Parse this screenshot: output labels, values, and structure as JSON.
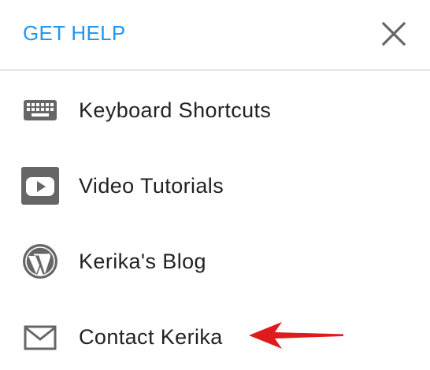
{
  "header": {
    "title": "GET HELP",
    "close_icon": "close-icon"
  },
  "menu": {
    "items": [
      {
        "label": "Keyboard Shortcuts",
        "icon": "keyboard-icon"
      },
      {
        "label": "Video Tutorials",
        "icon": "video-play-icon"
      },
      {
        "label": "Kerika's Blog",
        "icon": "wordpress-icon"
      },
      {
        "label": "Contact Kerika",
        "icon": "envelope-icon"
      }
    ]
  },
  "annotation": {
    "icon": "red-arrow-icon",
    "color": "#e01b1b"
  },
  "colors": {
    "accent": "#2196f3",
    "icon_gray": "#666666",
    "text": "#222222",
    "divider": "#e3e3e3"
  }
}
